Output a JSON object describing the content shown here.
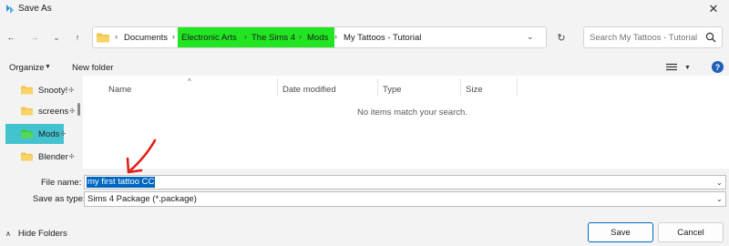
{
  "window": {
    "title": "Save As",
    "close_glyph": "✕"
  },
  "nav": {
    "back_glyph": "←",
    "forward_glyph": "→",
    "recent_glyph": "⌄",
    "up_glyph": "↑",
    "breadcrumbs": [
      "Documents",
      "Electronic Arts",
      "The Sims 4",
      "Mods",
      "My Tattoos - Tutorial"
    ],
    "separator": "›",
    "refresh_glyph": "↻"
  },
  "search": {
    "placeholder": "Search My Tattoos - Tutorial"
  },
  "toolbar": {
    "organize_label": "Organize",
    "new_folder_label": "New folder",
    "dropdown_glyph": "▼"
  },
  "sidebar": {
    "items": [
      {
        "label": "Snooty!",
        "pinned": true
      },
      {
        "label": "screens",
        "pinned": true
      },
      {
        "label": "Mods",
        "pinned": true,
        "highlighted": true
      },
      {
        "label": "Blender",
        "pinned": true
      }
    ],
    "pin_glyph": "📌"
  },
  "columns": [
    "Name",
    "Date modified",
    "Type",
    "Size"
  ],
  "empty_message": "No items match your search.",
  "form": {
    "file_name_label": "File name:",
    "file_name_value": "my first tattoo CC",
    "save_type_label": "Save as type:",
    "save_type_value": "Sims 4 Package (*.package)",
    "dd_glyph": "⌄"
  },
  "footer": {
    "hide_folders_label": "Hide Folders",
    "hide_glyph": "∧",
    "save_label": "Save",
    "cancel_label": "Cancel"
  },
  "colors": {
    "highlight_green": "#22e522",
    "highlight_cyan": "#44c3cf",
    "accent": "#0067c0",
    "annotation_red": "#e0201b"
  }
}
